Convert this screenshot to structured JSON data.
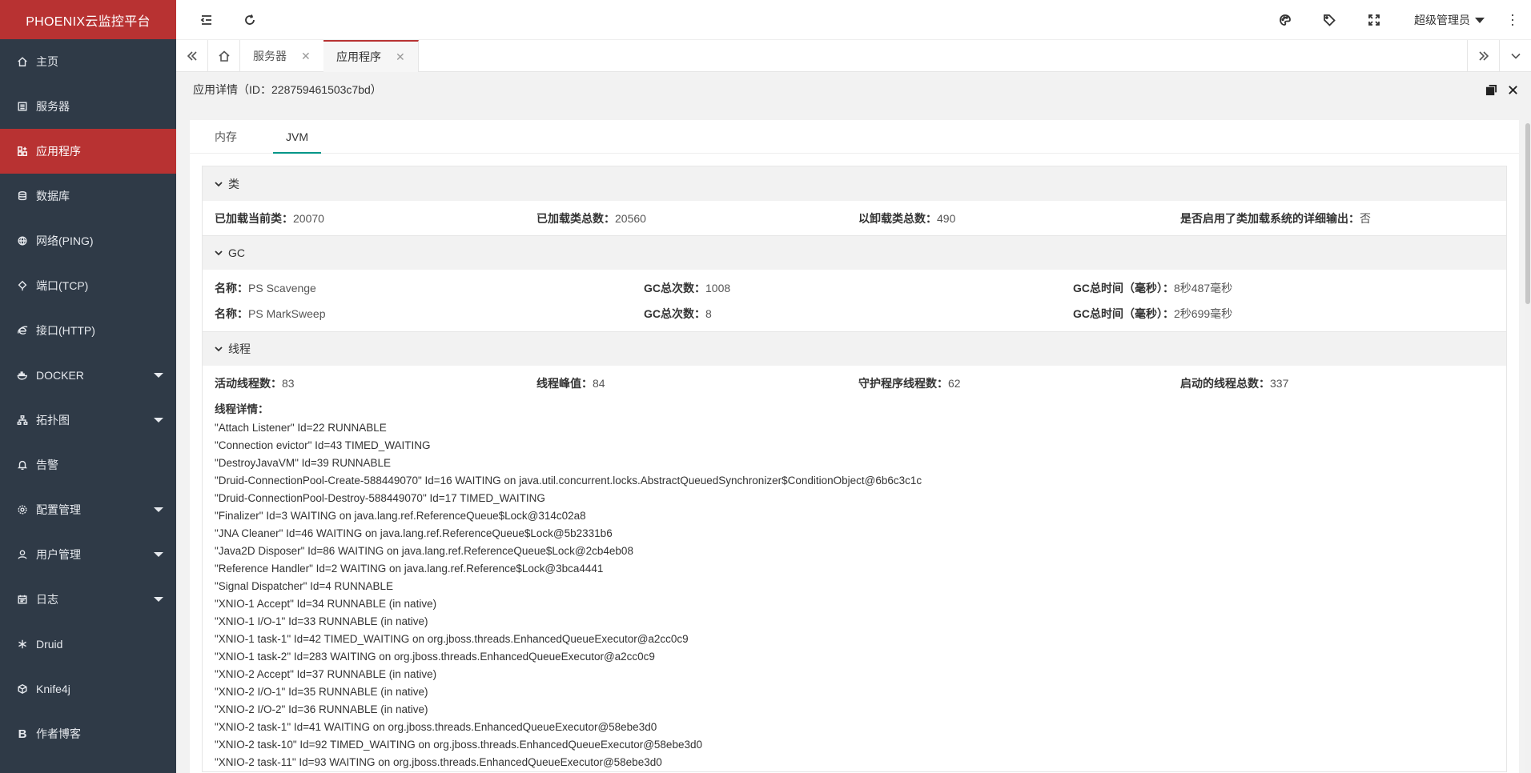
{
  "app": {
    "logo": "PHOENIX云监控平台"
  },
  "sidebar": {
    "items": [
      {
        "label": "主页"
      },
      {
        "label": "服务器"
      },
      {
        "label": "应用程序"
      },
      {
        "label": "数据库"
      },
      {
        "label": "网络(PING)"
      },
      {
        "label": "端口(TCP)"
      },
      {
        "label": "接口(HTTP)"
      },
      {
        "label": "DOCKER"
      },
      {
        "label": "拓扑图"
      },
      {
        "label": "告警"
      },
      {
        "label": "配置管理"
      },
      {
        "label": "用户管理"
      },
      {
        "label": "日志"
      },
      {
        "label": "Druid"
      },
      {
        "label": "Knife4j"
      },
      {
        "label": "作者博客"
      }
    ]
  },
  "header": {
    "user": "超级管理员"
  },
  "tabs": [
    {
      "label": "服务器"
    },
    {
      "label": "应用程序"
    }
  ],
  "page": {
    "title": "应用详情（ID：228759461503c7bd）"
  },
  "inner_tabs": [
    {
      "label": "内存"
    },
    {
      "label": "JVM"
    }
  ],
  "class_section": {
    "title": "类",
    "items": [
      {
        "label": "已加载当前类：",
        "value": "20070"
      },
      {
        "label": "已加载类总数：",
        "value": "20560"
      },
      {
        "label": "以卸载类总数：",
        "value": "490"
      },
      {
        "label": "是否启用了类加载系统的详细输出：",
        "value": "否"
      }
    ]
  },
  "gc_section": {
    "title": "GC",
    "rows": [
      {
        "name_label": "名称：",
        "name": "PS Scavenge",
        "count_label": "GC总次数：",
        "count": "1008",
        "time_label": "GC总时间（毫秒）：",
        "time": "8秒487毫秒"
      },
      {
        "name_label": "名称：",
        "name": "PS MarkSweep",
        "count_label": "GC总次数：",
        "count": "8",
        "time_label": "GC总时间（毫秒）：",
        "time": "2秒699毫秒"
      }
    ]
  },
  "thread_section": {
    "title": "线程",
    "items": [
      {
        "label": "活动线程数：",
        "value": "83"
      },
      {
        "label": "线程峰值：",
        "value": "84"
      },
      {
        "label": "守护程序线程数：",
        "value": "62"
      },
      {
        "label": "启动的线程总数：",
        "value": "337"
      }
    ],
    "detail_label": "线程详情：",
    "details": [
      "\"Attach Listener\" Id=22 RUNNABLE",
      "\"Connection evictor\" Id=43 TIMED_WAITING",
      "\"DestroyJavaVM\" Id=39 RUNNABLE",
      "\"Druid-ConnectionPool-Create-588449070\" Id=16 WAITING on java.util.concurrent.locks.AbstractQueuedSynchronizer$ConditionObject@6b6c3c1c",
      "\"Druid-ConnectionPool-Destroy-588449070\" Id=17 TIMED_WAITING",
      "\"Finalizer\" Id=3 WAITING on java.lang.ref.ReferenceQueue$Lock@314c02a8",
      "\"JNA Cleaner\" Id=46 WAITING on java.lang.ref.ReferenceQueue$Lock@5b2331b6",
      "\"Java2D Disposer\" Id=86 WAITING on java.lang.ref.ReferenceQueue$Lock@2cb4eb08",
      "\"Reference Handler\" Id=2 WAITING on java.lang.ref.Reference$Lock@3bca4441",
      "\"Signal Dispatcher\" Id=4 RUNNABLE",
      "\"XNIO-1 Accept\" Id=34 RUNNABLE (in native)",
      "\"XNIO-1 I/O-1\" Id=33 RUNNABLE (in native)",
      "\"XNIO-1 task-1\" Id=42 TIMED_WAITING on org.jboss.threads.EnhancedQueueExecutor@a2cc0c9",
      "\"XNIO-1 task-2\" Id=283 WAITING on org.jboss.threads.EnhancedQueueExecutor@a2cc0c9",
      "\"XNIO-2 Accept\" Id=37 RUNNABLE (in native)",
      "\"XNIO-2 I/O-1\" Id=35 RUNNABLE (in native)",
      "\"XNIO-2 I/O-2\" Id=36 RUNNABLE (in native)",
      "\"XNIO-2 task-1\" Id=41 WAITING on org.jboss.threads.EnhancedQueueExecutor@58ebe3d0",
      "\"XNIO-2 task-10\" Id=92 TIMED_WAITING on org.jboss.threads.EnhancedQueueExecutor@58ebe3d0",
      "\"XNIO-2 task-11\" Id=93 WAITING on org.jboss.threads.EnhancedQueueExecutor@58ebe3d0"
    ]
  },
  "colors": {
    "brand": "#b83232",
    "sidebar_bg": "#2f3a47",
    "tab_accent": "#009688"
  }
}
